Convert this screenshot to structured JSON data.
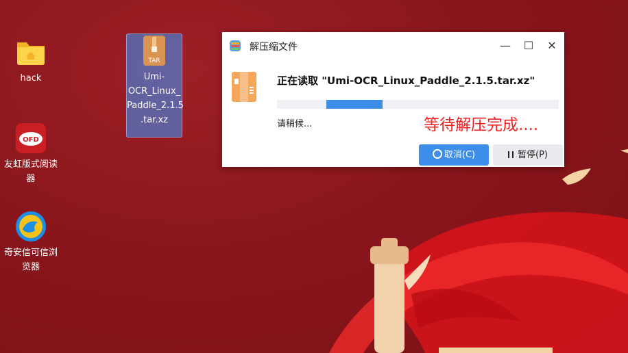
{
  "desktop": {
    "icons": [
      {
        "label": "hack",
        "icon": "folder-icon"
      },
      {
        "label": "Umi-OCR_Linux_Paddle_2.1.5.tar.xz",
        "icon": "tar-archive-icon",
        "badge": "TAR",
        "lines": [
          "Umi-",
          "OCR_Linux_",
          "Paddle_2.1.5",
          ".tar.xz"
        ]
      },
      {
        "label": "友虹版式阅读器",
        "icon": "ofd-reader-icon",
        "badge": "OFD",
        "lines": [
          "友虹版式阅读",
          "器"
        ]
      },
      {
        "label": "奇安信可信浏览器",
        "icon": "browser-icon",
        "lines": [
          "奇安信可信浏",
          "览器"
        ]
      }
    ]
  },
  "dialog": {
    "title": "解压缩文件",
    "reading_text": "正在读取 \"Umi-OCR_Linux_Paddle_2.1.5.tar.xz\"",
    "wait_text": "请稍候...",
    "annotation": "等待解压完成....",
    "progress_fraction": 0.2,
    "buttons": {
      "cancel": "取消(C)",
      "pause": "暂停(P)"
    },
    "window_controls": {
      "minimize": "—",
      "maximize": "☐",
      "close": "✕"
    }
  },
  "colors": {
    "accent": "#3d8ee8",
    "annotation": "#ee2222",
    "desktop_bg": "#8a161c"
  }
}
